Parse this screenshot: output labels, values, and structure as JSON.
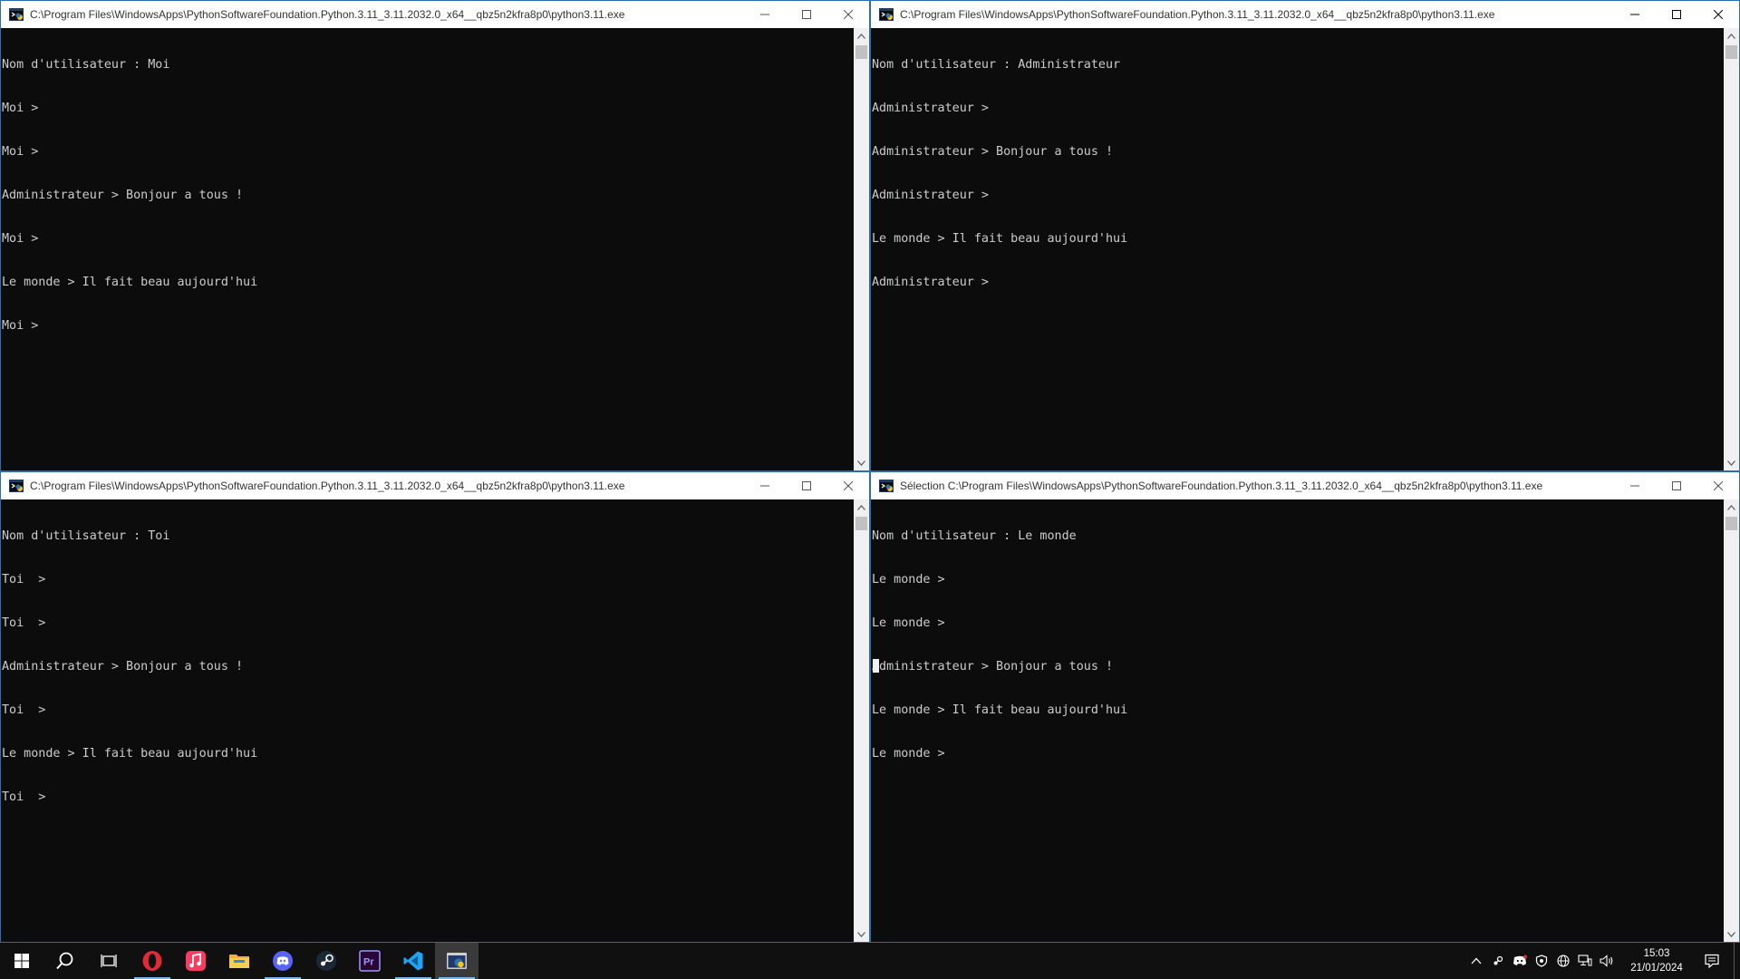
{
  "windows": [
    {
      "id": "tl",
      "title": "C:\\Program Files\\WindowsApps\\PythonSoftwareFoundation.Python.3.11_3.11.2032.0_x64__qbz5n2kfra8p0\\python3.11.exe",
      "lines": [
        "Nom d'utilisateur : Moi",
        "Moi >",
        "Moi >",
        "Administrateur > Bonjour a tous !",
        "Moi >",
        "Le monde > Il fait beau aujourd'hui",
        "Moi >"
      ]
    },
    {
      "id": "tr",
      "title": "C:\\Program Files\\WindowsApps\\PythonSoftwareFoundation.Python.3.11_3.11.2032.0_x64__qbz5n2kfra8p0\\python3.11.exe",
      "lines": [
        "Nom d'utilisateur : Administrateur",
        "Administrateur >",
        "Administrateur > Bonjour a tous !",
        "Administrateur >",
        "Le monde > Il fait beau aujourd'hui",
        "Administrateur >"
      ]
    },
    {
      "id": "bl",
      "title": "C:\\Program Files\\WindowsApps\\PythonSoftwareFoundation.Python.3.11_3.11.2032.0_x64__qbz5n2kfra8p0\\python3.11.exe",
      "lines": [
        "Nom d'utilisateur : Toi",
        "Toi  >",
        "Toi  >",
        "Administrateur > Bonjour a tous !",
        "Toi  >",
        "Le monde > Il fait beau aujourd'hui",
        "Toi  >"
      ]
    },
    {
      "id": "br",
      "title": "Sélection C:\\Program Files\\WindowsApps\\PythonSoftwareFoundation.Python.3.11_3.11.2032.0_x64__qbz5n2kfra8p0\\python3.11.exe",
      "lines": [
        "Nom d'utilisateur : Le monde",
        "Le monde >",
        "Le monde >",
        "Administrateur > Bonjour a tous !",
        "Le monde > Il fait beau aujourd'hui",
        "Le monde >"
      ]
    }
  ],
  "taskbar": {
    "apps": [
      {
        "name": "start-button",
        "icon": "windows-logo-icon",
        "running": false
      },
      {
        "name": "search-button",
        "icon": "search-icon",
        "running": false
      },
      {
        "name": "task-view-button",
        "icon": "task-view-icon",
        "running": false
      },
      {
        "name": "opera-app",
        "icon": "opera-icon",
        "running": true
      },
      {
        "name": "itunes-app",
        "icon": "music-icon",
        "running": false
      },
      {
        "name": "file-explorer-app",
        "icon": "folder-icon",
        "running": false
      },
      {
        "name": "discord-app",
        "icon": "discord-icon",
        "running": true
      },
      {
        "name": "steam-app",
        "icon": "steam-icon",
        "running": false
      },
      {
        "name": "premiere-app",
        "icon": "premiere-icon",
        "running": false
      },
      {
        "name": "vscode-app",
        "icon": "vscode-icon",
        "running": true
      },
      {
        "name": "python-app",
        "icon": "python-icon",
        "running": true
      }
    ],
    "premiere_label": "Pr",
    "clock": {
      "time": "15:03",
      "date": "21/01/2024"
    }
  },
  "colors": {
    "console_bg": "#0c0c0c",
    "console_text": "#cccccc",
    "taskbar_bg": "#101010",
    "running_indicator": "#76b9ed",
    "opera_red": "#e02a36",
    "itunes_pink": "#fb3b62",
    "discord_blue": "#5865f2",
    "vscode_blue": "#23a2f0",
    "premiere_purple": "#9999ff"
  }
}
